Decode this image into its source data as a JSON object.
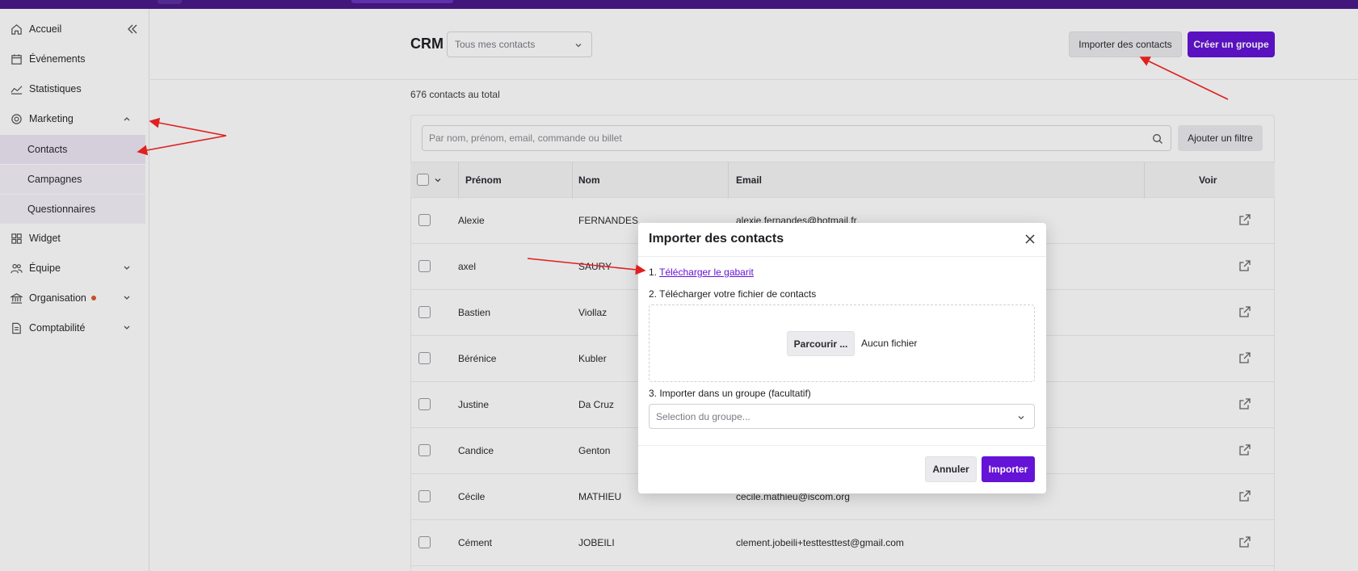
{
  "sidebar": {
    "items": [
      {
        "label": "Accueil",
        "icon": "home-icon"
      },
      {
        "label": "Événements",
        "icon": "calendar-icon"
      },
      {
        "label": "Statistiques",
        "icon": "chart-line-icon"
      },
      {
        "label": "Marketing",
        "icon": "target-icon"
      },
      {
        "label": "Widget",
        "icon": "widget-icon"
      },
      {
        "label": "Équipe",
        "icon": "team-icon"
      },
      {
        "label": "Organisation",
        "icon": "bank-icon"
      },
      {
        "label": "Comptabilité",
        "icon": "document-icon"
      }
    ],
    "marketing_sub": [
      {
        "label": "Contacts"
      },
      {
        "label": "Campagnes"
      },
      {
        "label": "Questionnaires"
      }
    ],
    "notification_color": "#e0582a"
  },
  "header": {
    "title": "CRM",
    "filter_value": "Tous mes contacts",
    "import_button": "Importer des contacts",
    "create_group_button": "Créer un groupe"
  },
  "main": {
    "total": "676 contacts au total",
    "search_placeholder": "Par nom, prénom, email, commande ou billet",
    "filter_button": "Ajouter un filtre",
    "columns": [
      "Prénom",
      "Nom",
      "Email",
      "Voir"
    ],
    "rows": [
      {
        "first": "Alexie",
        "last": "FERNANDES",
        "email": "alexie.fernandes@hotmail.fr"
      },
      {
        "first": "axel",
        "last": "SAURY",
        "email": ""
      },
      {
        "first": "Bastien",
        "last": "Viollaz",
        "email": ""
      },
      {
        "first": "Bérénice",
        "last": "Kubler",
        "email": ""
      },
      {
        "first": "Justine",
        "last": "Da Cruz",
        "email": ""
      },
      {
        "first": "Candice",
        "last": "Genton",
        "email": ""
      },
      {
        "first": "Cécile",
        "last": "MATHIEU",
        "email": "cecile.mathieu@iscom.org"
      },
      {
        "first": "Cément",
        "last": "JOBEILI",
        "email": "clement.jobeili+testtesttest@gmail.com"
      }
    ]
  },
  "modal": {
    "title": "Importer des contacts",
    "step1_prefix": "1. ",
    "step1_link": "Télécharger le gabarit",
    "step2": "2. Télécharger votre fichier de contacts",
    "browse_button": "Parcourir ...",
    "no_file": "Aucun fichier",
    "step3": "3. Importer dans un groupe (facultatif)",
    "group_placeholder": "Selection du groupe...",
    "cancel_button": "Annuler",
    "import_button": "Importer"
  },
  "colors": {
    "brand": "#6513d6",
    "topbar": "#4a1a8a",
    "annotation": "#e02020"
  }
}
